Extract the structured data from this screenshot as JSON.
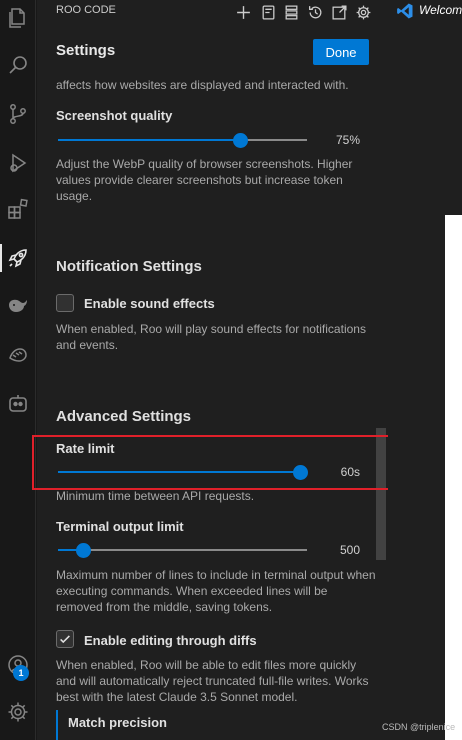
{
  "activity_bar": {
    "icons": [
      "files-icon",
      "search-icon",
      "source-control-icon",
      "run-debug-icon",
      "extensions-icon",
      "roo-rocket-icon",
      "whale-icon",
      "cline-icon",
      "robot-icon"
    ],
    "account_badge": "1"
  },
  "panel": {
    "title": "ROO CODE",
    "toolbar_icons": [
      "plus-icon",
      "prompts-icon",
      "mcp-servers-icon",
      "history-icon",
      "popout-icon",
      "gear-icon"
    ]
  },
  "settings": {
    "title": "Settings",
    "done_label": "Done",
    "browser_viewport_desc_tail": "affects how websites are displayed and interacted with.",
    "screenshot_quality": {
      "label": "Screenshot quality",
      "value": "75%",
      "fraction": 0.73,
      "description": "Adjust the WebP quality of browser screenshots. Higher values provide clearer screenshots but increase token usage."
    },
    "notification": {
      "heading": "Notification Settings",
      "sound_label": "Enable sound effects",
      "sound_checked": false,
      "sound_description": "When enabled, Roo will play sound effects for notifications and events."
    },
    "advanced": {
      "heading": "Advanced Settings",
      "rate_limit": {
        "label": "Rate limit",
        "value": "60s",
        "fraction": 0.97,
        "description": "Minimum time between API requests."
      },
      "terminal_output_limit": {
        "label": "Terminal output limit",
        "value": "500",
        "fraction": 0.1,
        "description": "Maximum number of lines to include in terminal output when executing commands. When exceeded lines will be removed from the middle, saving tokens."
      },
      "diff_editing": {
        "label": "Enable editing through diffs",
        "checked": true,
        "description": "When enabled, Roo will be able to edit files more quickly and will automatically reject truncated full-file writes. Works best with the latest Claude 3.5 Sonnet model."
      },
      "match_precision_label": "Match precision"
    }
  },
  "editor": {
    "tab_title": "Welcome"
  },
  "watermark": "CSDN @triplenice",
  "colors": {
    "accent": "#0078d4",
    "highlight": "#e0202a"
  }
}
